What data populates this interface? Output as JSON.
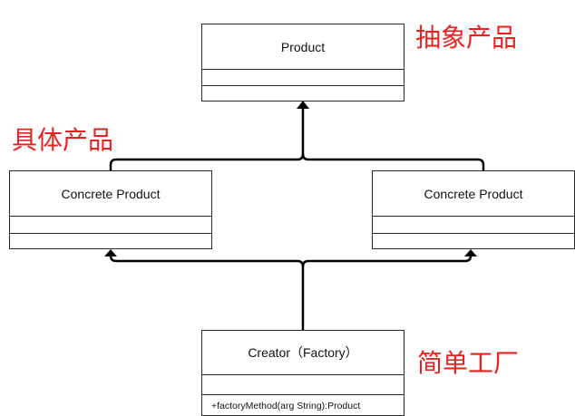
{
  "annotations": {
    "abstract_product": "抽象产品",
    "concrete_product": "具体产品",
    "simple_factory": "简单工厂"
  },
  "classes": {
    "product": {
      "name": "Product"
    },
    "concrete_left": {
      "name": "Concrete Product"
    },
    "concrete_right": {
      "name": "Concrete Product"
    },
    "creator": {
      "name": "Creator（Factory）",
      "operation": "+factoryMethod(arg String):Product"
    }
  },
  "colors": {
    "annotation": "#e8231f",
    "line": "#000000",
    "border": "#2a2a2a"
  }
}
